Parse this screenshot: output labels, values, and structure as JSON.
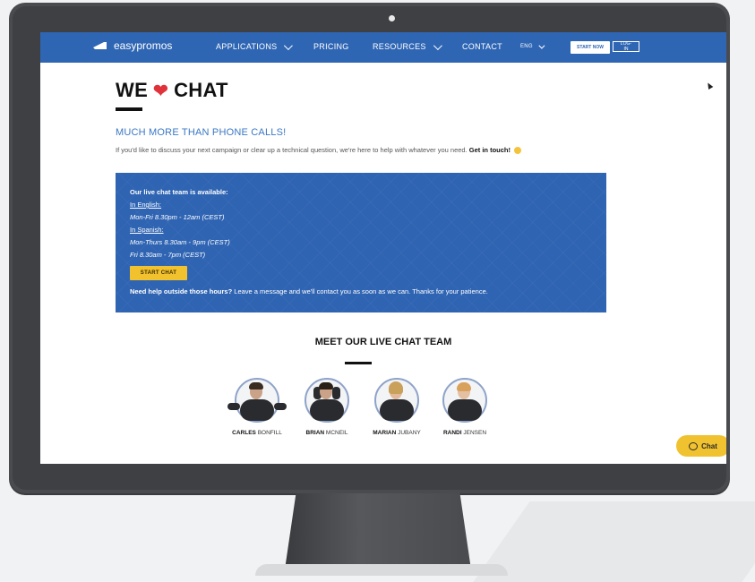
{
  "nav": {
    "brand": "easypromos",
    "items": [
      {
        "label": "APPLICATIONS",
        "dropdown": true
      },
      {
        "label": "PRICING",
        "dropdown": false
      },
      {
        "label": "RESOURCES",
        "dropdown": true
      },
      {
        "label": "CONTACT",
        "dropdown": false
      }
    ],
    "language": "ENG",
    "start_now": "START NOW",
    "login": "LOG-IN"
  },
  "page": {
    "title_left": "WE",
    "title_right": "CHAT",
    "subtitle": "MUCH MORE THAN PHONE CALLS!",
    "intro": "If you'd like to discuss your next campaign or clear up a technical question, we're here to help with whatever you need.",
    "intro_bold": "Get in touch!"
  },
  "chatbox": {
    "heading": "Our live chat team is available:",
    "english_label": "In English:",
    "english_hours": "Mon-Fri 8.30pm - 12am (CEST)",
    "spanish_label": "In Spanish:",
    "spanish_hours_1": "Mon-Thurs 8.30am - 9pm (CEST)",
    "spanish_hours_2": "Fri 8.30am - 7pm (CEST)",
    "start_chat": "START CHAT",
    "foot_bold": "Need help outside those hours?",
    "foot_text": "Leave a message and we'll contact you as soon as we can. Thanks for your patience."
  },
  "team": {
    "title": "MEET OUR LIVE CHAT TEAM",
    "members": [
      {
        "first": "CARLES",
        "last": "BONFILL"
      },
      {
        "first": "BRIAN",
        "last": "MCNEIL"
      },
      {
        "first": "MARIAN",
        "last": "JUBANY"
      },
      {
        "first": "RANDI",
        "last": "JENSEN"
      }
    ]
  },
  "widget": {
    "label": "Chat"
  },
  "colors": {
    "nav_blue": "#2f66b4",
    "accent_yellow": "#f2c12e",
    "link_blue": "#3a78c4"
  }
}
